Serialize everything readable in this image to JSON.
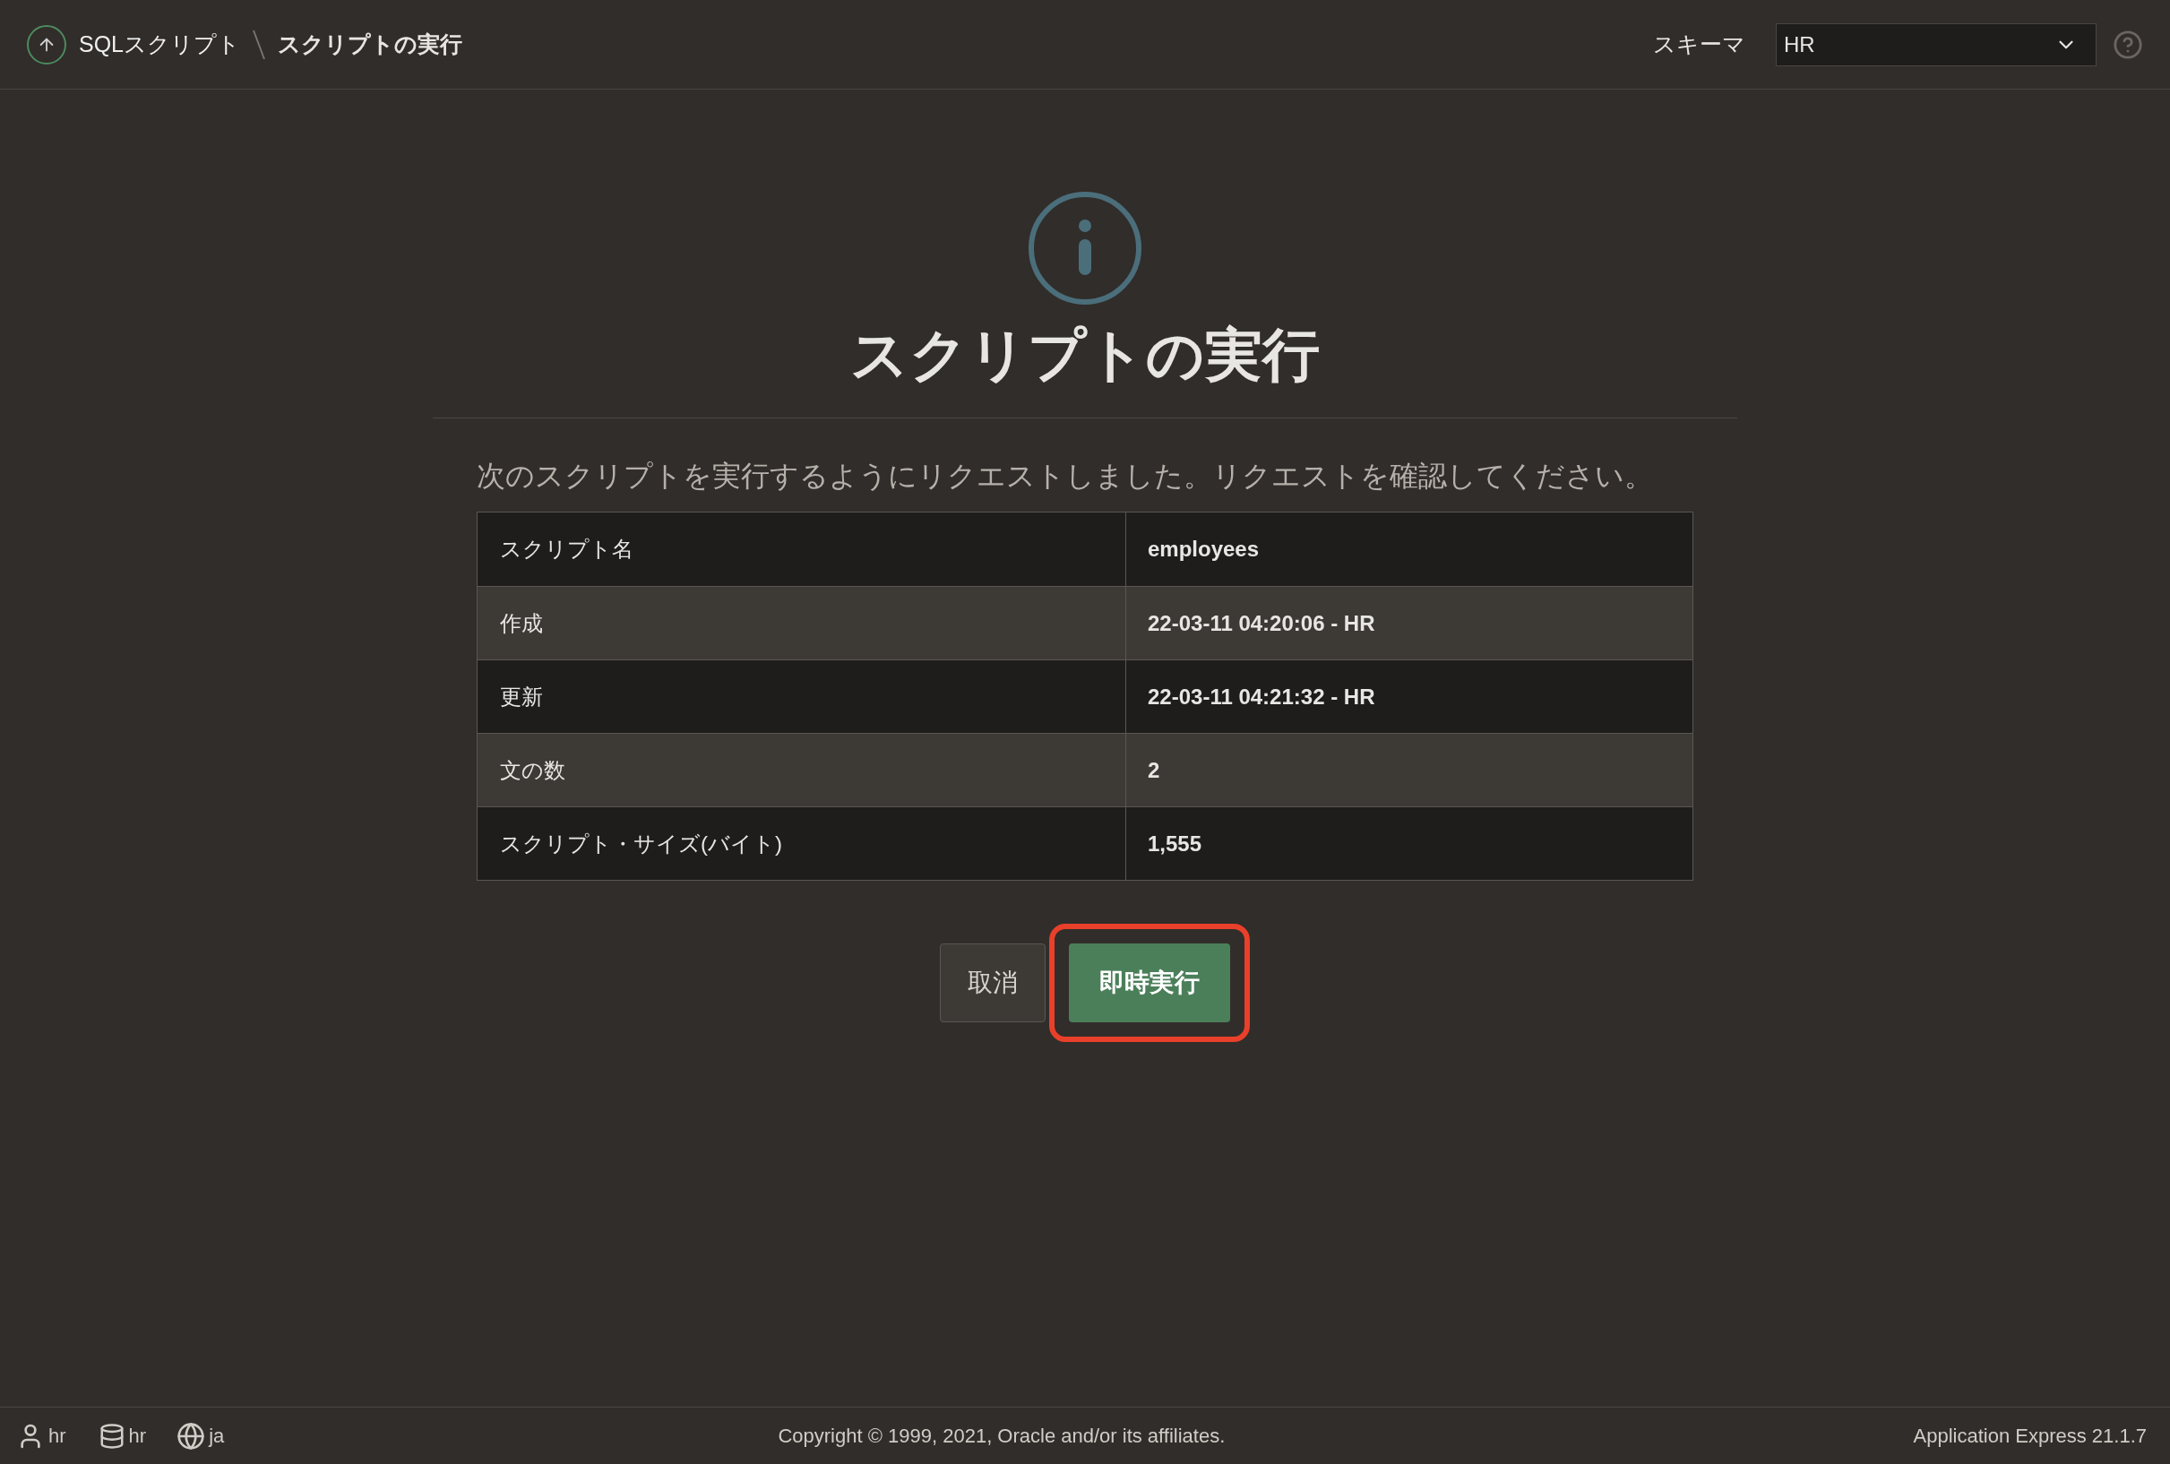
{
  "breadcrumb": [
    {
      "label": "SQLスクリプト",
      "current": false
    },
    {
      "label": "スクリプトの実行",
      "current": true
    }
  ],
  "schema": {
    "label": "スキーマ",
    "value": "HR"
  },
  "title": "スクリプトの実行",
  "message": "次のスクリプトを実行するようにリクエストしました。リクエストを確認してください。",
  "table": {
    "rows": [
      {
        "label": "スクリプト名",
        "value": "employees"
      },
      {
        "label": "作成",
        "value": "22-03-11 04:20:06 - HR"
      },
      {
        "label": "更新",
        "value": "22-03-11 04:21:32 - HR"
      },
      {
        "label": "文の数",
        "value": "2"
      },
      {
        "label": "スクリプト・サイズ(バイト)",
        "value": "1,555"
      }
    ]
  },
  "buttons": [
    {
      "label": "取消",
      "kind": "secondary",
      "highlighted": false
    },
    {
      "label": "即時実行",
      "kind": "primary",
      "highlighted": true
    }
  ],
  "footer": {
    "user": "hr",
    "schema": "hr",
    "language": "ja",
    "copyright": "Copyright © 1999, 2021, Oracle and/or its affiliates.",
    "version": "Application Express 21.1.7"
  }
}
